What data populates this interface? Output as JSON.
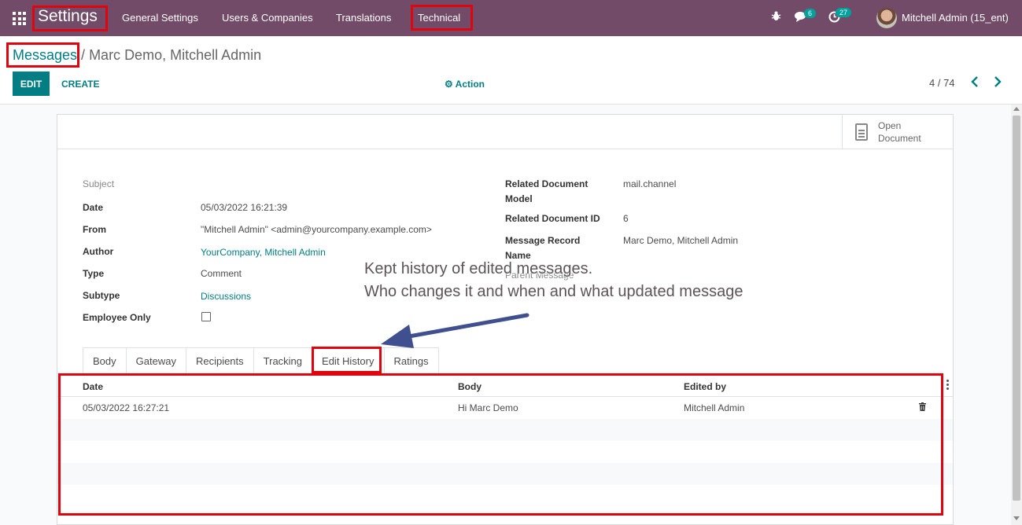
{
  "navbar": {
    "app_title": "Settings",
    "menus": [
      "General Settings",
      "Users & Companies",
      "Translations",
      "Technical"
    ],
    "messages_count": "6",
    "activity_count": "27",
    "user_name": "Mitchell Admin (15_ent)"
  },
  "breadcrumb": {
    "parent": "Messages",
    "separator": " / ",
    "current": "Marc Demo, Mitchell Admin"
  },
  "buttons": {
    "edit": "EDIT",
    "create": "CREATE",
    "action": "Action"
  },
  "pager": {
    "value": "4 / 74"
  },
  "open_document": {
    "label": "Open Document"
  },
  "left_fields": [
    {
      "label": "Subject",
      "value": ""
    },
    {
      "label": "Date",
      "value": "05/03/2022 16:21:39"
    },
    {
      "label": "From",
      "value": "\"Mitchell Admin\" <admin@yourcompany.example.com>"
    },
    {
      "label": "Author",
      "value": "YourCompany, Mitchell Admin"
    },
    {
      "label": "Type",
      "value": "Comment"
    },
    {
      "label": "Subtype",
      "value": "Discussions"
    },
    {
      "label": "Employee Only",
      "value": ""
    }
  ],
  "right_fields": [
    {
      "label": "Related Document Model",
      "value": "mail.channel"
    },
    {
      "label": "Related Document ID",
      "value": "6"
    },
    {
      "label": "Message Record Name",
      "value": "Marc Demo, Mitchell Admin"
    },
    {
      "label": "Parent Message",
      "value": ""
    }
  ],
  "tabs": [
    "Body",
    "Gateway",
    "Recipients",
    "Tracking",
    "Edit History",
    "Ratings"
  ],
  "active_tab": "Edit History",
  "history_table": {
    "columns": [
      "Date",
      "Body",
      "Edited by"
    ],
    "rows": [
      {
        "date": "05/03/2022 16:27:21",
        "body": "Hi Marc Demo",
        "edited_by": "Mitchell Admin"
      }
    ]
  },
  "annotation": {
    "line1": "Kept history of edited messages.",
    "line2": "Who changes it and when and what updated message"
  },
  "colors": {
    "navbar": "#714b67",
    "accent": "#017e84",
    "badge": "#00a09d",
    "highlight": "#e0040f",
    "arrow": "#3f4f8f"
  }
}
